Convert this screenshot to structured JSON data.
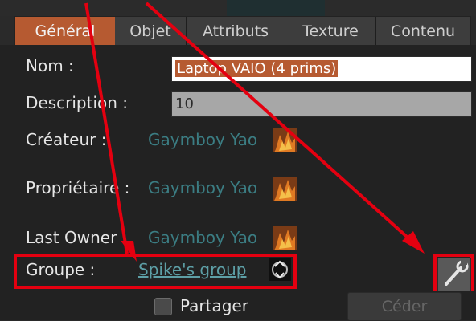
{
  "tabs": [
    {
      "label": "Général",
      "active": true
    },
    {
      "label": "Objet",
      "active": false
    },
    {
      "label": "Attributs",
      "active": false
    },
    {
      "label": "Texture",
      "active": false
    },
    {
      "label": "Contenu",
      "active": false
    }
  ],
  "fields": {
    "name": {
      "label": "Nom :",
      "value": "Laptop VAIO (4 prims)"
    },
    "description": {
      "label": "Description :",
      "value": "10"
    },
    "creator": {
      "label": "Créateur :",
      "value": "Gaymboy Yao"
    },
    "owner": {
      "label": "Propriétaire :",
      "value": "Gaymboy Yao"
    },
    "last_owner": {
      "label": "Last Owner :",
      "value": "Gaymboy Yao"
    },
    "group": {
      "label": "Groupe :",
      "value": "Spike's group"
    }
  },
  "share": {
    "label": "Partager",
    "checked": false
  },
  "deed_button": {
    "label": "Céder",
    "enabled": false
  },
  "colors": {
    "accent": "#b65a31",
    "link": "#3b7d83",
    "highlight": "#e40010"
  },
  "icons": [
    "avatar-thumbnail",
    "group-thumbnail",
    "wrench-icon",
    "arrow-annotation"
  ]
}
